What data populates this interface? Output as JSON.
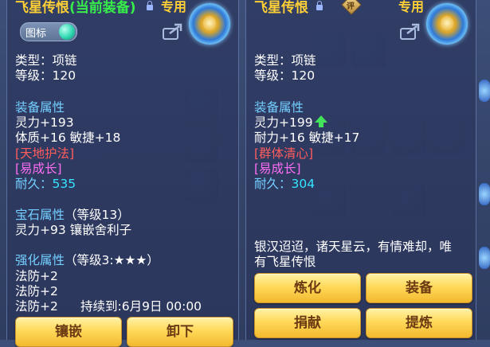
{
  "left_panel": {
    "title": "飞星传恨",
    "title_suffix": "(当前装备)",
    "exclusive_label": "专用",
    "icon_tag_label": "图标",
    "type_line": "类型：项链",
    "level_line": "等级：120",
    "attr_header": "装备属性",
    "stat_line_1": "灵力+193",
    "stat_line_2": "体质+16 敏捷+18",
    "skill_special": "[天地护法]",
    "skill_trait": "[易成长]",
    "durability_label": "耐久：",
    "durability_value": "535",
    "gem_header": "宝石属性",
    "gem_level": "（等级13）",
    "gem_line": "灵力+93 镶嵌舍利子",
    "enhance_header": "强化属性",
    "enhance_level": "（等级3:",
    "enhance_stars": "★★★",
    "enhance_close": "）",
    "enhance_line_1": "法防+2",
    "enhance_line_2": "法防+2",
    "enhance_line_3": "法防+2",
    "enhance_duration": "持续到:6月9日 00:00",
    "buttons": {
      "inlay": "镶嵌",
      "unequip": "卸下"
    }
  },
  "right_panel": {
    "title": "飞星传恨",
    "exclusive_label": "专用",
    "badge_label": "评",
    "type_line": "类型：项链",
    "level_line": "等级：120",
    "attr_header": "装备属性",
    "stat_line_1": "灵力+199",
    "stat_line_2": "耐力+16 敏捷+17",
    "skill_special": "[群体清心]",
    "skill_trait": "[易成长]",
    "durability_label": "耐久：",
    "durability_value": "304",
    "description_1": "银汉迢迢，诸天星云，有情难却，唯",
    "description_2": "有飞星传恨",
    "buttons": {
      "refine": "炼化",
      "equip": "装备",
      "donate": "捐献",
      "purify": "提炼"
    }
  },
  "colors": {
    "gold": "#ffd035",
    "stat_green": "#38ee4a",
    "skill_red": "#ff5d5d",
    "trait_magenta": "#ff6df4",
    "durability_cyan": "#34e6ff",
    "attr_header_blue": "#74cfff",
    "button_gold": "#ffd95a"
  },
  "icons": [
    "lock-icon",
    "share-icon",
    "medallion-icon",
    "gem-orb-icon",
    "arrow-up-icon",
    "appraise-badge-icon"
  ]
}
